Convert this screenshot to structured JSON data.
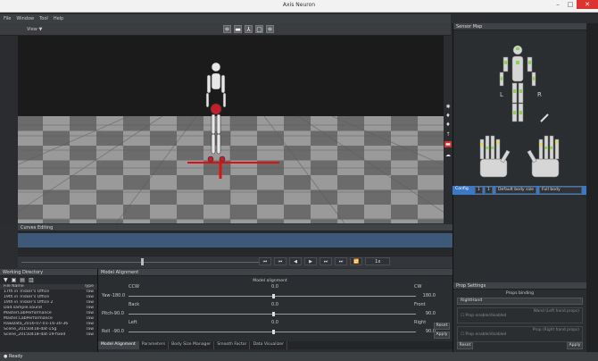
{
  "window": {
    "title": "Axis Neuron"
  },
  "menu": [
    "File",
    "Window",
    "Tool",
    "Help"
  ],
  "toolbar": {
    "view_label": "View",
    "view_arrow": "▼"
  },
  "view_buttons": [
    "⚛",
    "▬",
    "⅄",
    "▢",
    "⚛"
  ],
  "right_strip_icons": [
    "✺",
    "♦",
    "♦",
    "↑",
    "▬",
    "☁"
  ],
  "curve_panel": {
    "title": "Curves Editing"
  },
  "timeline": {
    "frame_value": "1x"
  },
  "transport": [
    "⏮",
    "⏮",
    "◀",
    "▶",
    "⏭",
    "⏭",
    "🔁"
  ],
  "file_board": {
    "title": "Working Directory",
    "col_name": "File Name",
    "col_type": "Type",
    "files": [
      {
        "name": "17th in Trisker's Office",
        "type": "raw"
      },
      {
        "name": "19th in Trisker's Office",
        "type": "raw"
      },
      {
        "name": "19th in Trisker's Office 2",
        "type": "raw"
      },
      {
        "name": "Dad.sample.sound",
        "type": "raw"
      },
      {
        "name": "MasterCabPerformance",
        "type": "raw"
      },
      {
        "name": "Master.CabPerformance",
        "type": "raw"
      },
      {
        "name": "RawData_2016-07-01-16-30-36",
        "type": "raw"
      },
      {
        "name": "Scene_20150418-dat-15g",
        "type": "raw"
      },
      {
        "name": "Scene_20150418-dat-19-fixed",
        "type": "raw"
      }
    ]
  },
  "model_alignment": {
    "title": "Model Alignment",
    "heading": "Model alignment",
    "rows": [
      {
        "label": "Yaw",
        "min": "-180.0",
        "left": "CCW",
        "center": "0.0",
        "right": "CW",
        "max": "180.0",
        "value": 0.5
      },
      {
        "label": "Pitch",
        "min": "-90.0",
        "left": "Back",
        "center": "0.0",
        "right": "Front",
        "max": "90.0",
        "value": 0.5
      },
      {
        "label": "Roll",
        "min": "-90.0",
        "left": "Left",
        "center": "0.0",
        "right": "Right",
        "max": "90.0",
        "value": 0.5
      }
    ],
    "reset_label": "Reset",
    "apply_label": "Apply"
  },
  "tabs": [
    "Model Alignment",
    "Parameters",
    "Body Size Manager",
    "Smooth Factor",
    "Data Visualizer"
  ],
  "sensor_map": {
    "title": "Sensor Map",
    "left_label": "L",
    "right_label": "R",
    "controls": {
      "config_label": "Config",
      "num1": "1",
      "num2": "1",
      "body_size": "Default body size",
      "body_type": "Full body"
    }
  },
  "prop_settings": {
    "title": "Prop Settings",
    "heading": "Props binding",
    "selected": "RightHand",
    "group1_title": "Wand (Left hand props)",
    "group2_title": "Prop (Right hand props)",
    "prop_enable": "Prop enable/disabled",
    "reset_label": "Reset",
    "apply_label": "Apply"
  },
  "status": {
    "text": "Ready"
  },
  "colors": {
    "accent_blue": "#3b79c6",
    "grid_light": "#9a9a9a",
    "grid_dark": "#6b6b6b",
    "sky": "#1b1b1b",
    "axis_red": "#e01010"
  }
}
